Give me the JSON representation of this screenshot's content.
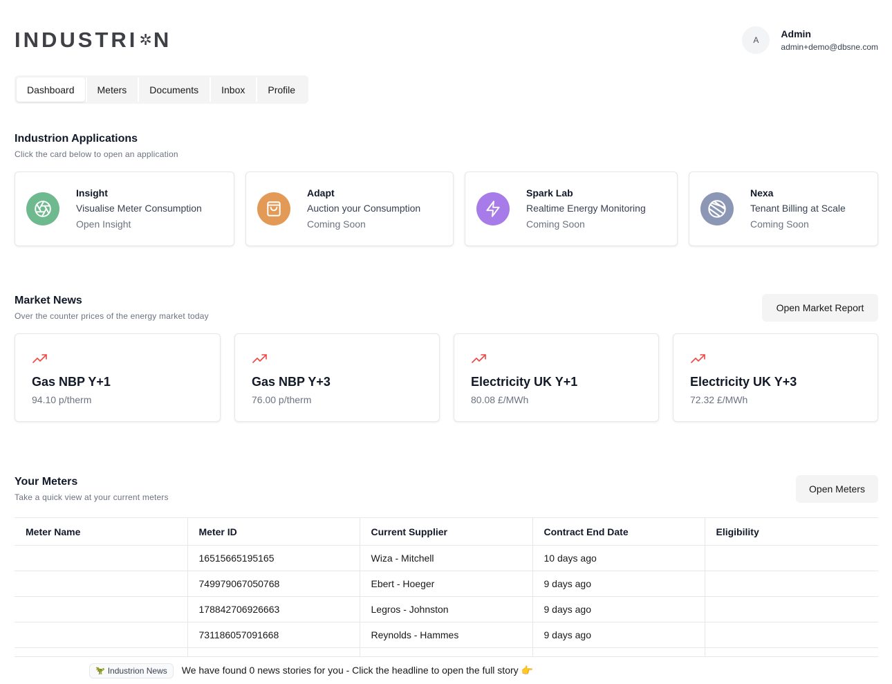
{
  "brand": {
    "logo_left": "INDUSTRI",
    "logo_star": "✲",
    "logo_right": "N"
  },
  "user": {
    "initial": "A",
    "name": "Admin",
    "email": "admin+demo@dbsne.com"
  },
  "tabs": [
    {
      "label": "Dashboard",
      "active": true
    },
    {
      "label": "Meters"
    },
    {
      "label": "Documents"
    },
    {
      "label": "Inbox"
    },
    {
      "label": "Profile"
    }
  ],
  "applications": {
    "title": "Industrion Applications",
    "subtitle": "Click the card below to open an application",
    "cards": [
      {
        "name": "Insight",
        "description": "Visualise Meter Consumption",
        "status": "Open Insight",
        "icon": "aperture-icon",
        "color": "#6fb98f"
      },
      {
        "name": "Adapt",
        "description": "Auction your Consumption",
        "status": "Coming Soon",
        "icon": "shopping-bag-icon",
        "color": "#e39a57"
      },
      {
        "name": "Spark Lab",
        "description": "Realtime Energy Monitoring",
        "status": "Coming Soon",
        "icon": "lightning-icon",
        "color": "#a77ce8"
      },
      {
        "name": "Nexa",
        "description": "Tenant Billing at Scale",
        "status": "Coming Soon",
        "icon": "globe-slash-icon",
        "color": "#8c96b5"
      }
    ]
  },
  "market": {
    "title": "Market News",
    "subtitle": "Over the counter prices of the energy market today",
    "button": "Open Market Report",
    "items": [
      {
        "title": "Gas NBP Y+1",
        "price": "94.10 p/therm",
        "icon": "trending-up-icon"
      },
      {
        "title": "Gas NBP Y+3",
        "price": "76.00 p/therm",
        "icon": "trending-up-icon"
      },
      {
        "title": "Electricity UK Y+1",
        "price": "80.08 £/MWh",
        "icon": "trending-up-icon"
      },
      {
        "title": "Electricity UK Y+3",
        "price": "72.32 £/MWh",
        "icon": "trending-up-icon"
      }
    ],
    "trend_color": "#ef4444"
  },
  "meters": {
    "title": "Your Meters",
    "subtitle": "Take a quick view at your current meters",
    "button": "Open Meters",
    "columns": [
      "Meter Name",
      "Meter ID",
      "Current Supplier",
      "Contract End Date",
      "Eligibility"
    ],
    "rows": [
      [
        "",
        "16515665195165",
        "Wiza - Mitchell",
        "10 days ago",
        ""
      ],
      [
        "",
        "749979067050768",
        "Ebert - Hoeger",
        "9 days ago",
        ""
      ],
      [
        "",
        "178842706926663",
        "Legros - Johnston",
        "9 days ago",
        ""
      ],
      [
        "",
        "731186057091668",
        "Reynolds - Hammes",
        "9 days ago",
        ""
      ]
    ]
  },
  "ticker": {
    "badge_icon": "🦖",
    "badge": "Industrion News",
    "text": "We have found 0 news stories for you - Click the headline to open the full story 👉"
  }
}
